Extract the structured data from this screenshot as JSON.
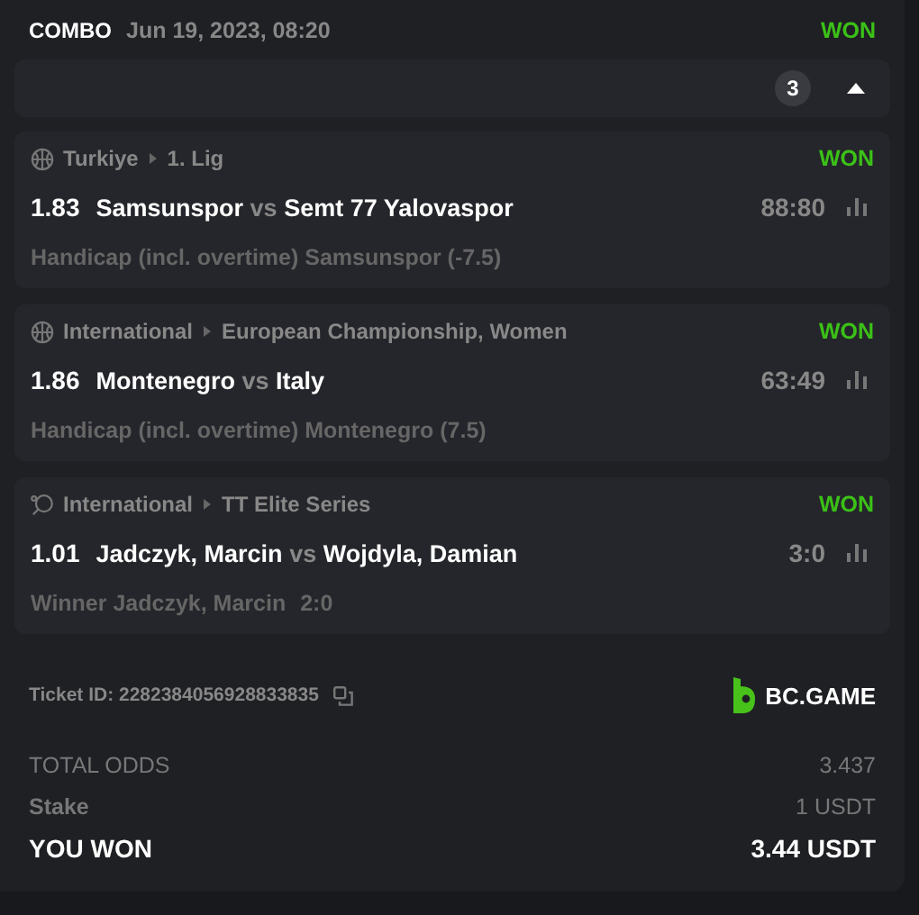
{
  "header": {
    "type": "COMBO",
    "date": "Jun 19, 2023, 08:20",
    "status": "WON"
  },
  "collapse": {
    "count": "3",
    "expanded": true
  },
  "bets": [
    {
      "kind": "basketball",
      "country": "Turkiye",
      "league": "1. Lig",
      "status": "WON",
      "odds": "1.83",
      "home": "Samsunspor",
      "vs": "vs",
      "away": "Semt 77 Yalovaspor",
      "score": "88:80",
      "market": "Handicap (incl. overtime) Samsunspor (-7.5)"
    },
    {
      "kind": "basketball",
      "country": "International",
      "league": "European Championship, Women",
      "status": "WON",
      "odds": "1.86",
      "home": "Montenegro",
      "vs": "vs",
      "away": "Italy",
      "score": "63:49",
      "market": "Handicap (incl. overtime) Montenegro (7.5)"
    },
    {
      "kind": "table-tennis",
      "country": "International",
      "league": "TT Elite Series",
      "status": "WON",
      "odds": "1.01",
      "home": "Jadczyk, Marcin",
      "vs": "vs",
      "away": "Wojdyla, Damian",
      "score": "3:0",
      "market": "Winner Jadczyk, Marcin",
      "market_score": "2:0"
    }
  ],
  "ticket": {
    "label": "Ticket ID: 2282384056928833835",
    "brand": "BC.GAME"
  },
  "totals": [
    {
      "kind": "plain",
      "label": "TOTAL ODDS",
      "value": "3.437"
    },
    {
      "kind": "plain",
      "label": "Stake",
      "value": "1 USDT"
    },
    {
      "kind": "highlight",
      "label": "YOU WON",
      "value": "3.44 USDT"
    }
  ]
}
